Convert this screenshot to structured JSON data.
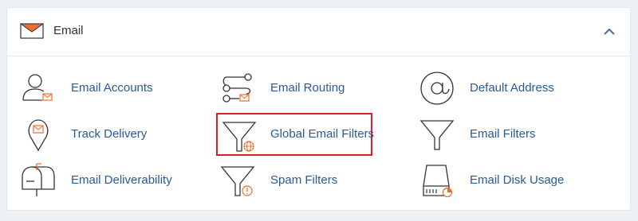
{
  "section": {
    "title": "Email",
    "icon": "envelope-icon",
    "collapse_icon": "chevron-up-icon"
  },
  "colors": {
    "link": "#295a94",
    "accent": "#f26c2b",
    "highlight_border": "#d91e2a"
  },
  "items": [
    {
      "label": "Email Accounts",
      "icon": "user-mail-icon"
    },
    {
      "label": "Email Routing",
      "icon": "routing-icon"
    },
    {
      "label": "Default Address",
      "icon": "at-sign-icon"
    },
    {
      "label": "Track Delivery",
      "icon": "map-pin-mail-icon"
    },
    {
      "label": "Global Email Filters",
      "icon": "funnel-globe-icon",
      "highlighted": true
    },
    {
      "label": "Email Filters",
      "icon": "funnel-icon"
    },
    {
      "label": "Email Deliverability",
      "icon": "mailbox-icon"
    },
    {
      "label": "Spam Filters",
      "icon": "funnel-alert-icon"
    },
    {
      "label": "Email Disk Usage",
      "icon": "disk-usage-icon"
    }
  ]
}
